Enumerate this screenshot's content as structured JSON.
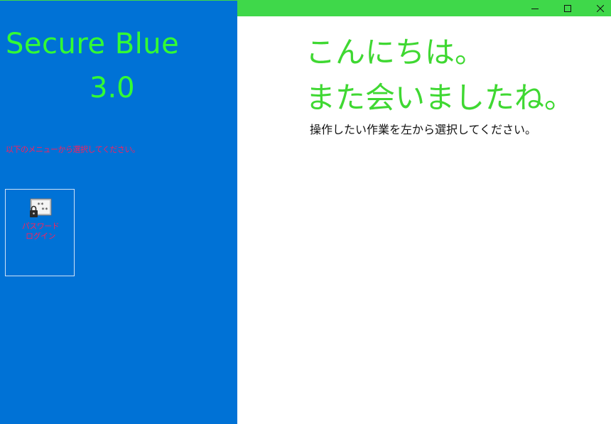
{
  "sidebar": {
    "app_title": "Secure Blue",
    "app_version": "3.0",
    "menu_hint": "以下のメニューから選択してください。",
    "menu_items": [
      {
        "label_line1": "パスワード",
        "label_line2": "ログイン",
        "icon": "password-lock-icon"
      }
    ]
  },
  "main": {
    "greeting_line1": "こんにちは。",
    "greeting_line2": "また会いましたね。",
    "instruction": "操作したい作業を左から選択してください。"
  },
  "window_controls": {
    "minimize_icon": "minimize-icon",
    "maximize_icon": "maximize-icon",
    "close_icon": "close-icon"
  },
  "colors": {
    "sidebar_bg": "#0072d6",
    "titlebar_bg": "#3fd84a",
    "title_text": "#33ff33",
    "hint_text": "#ff1e5a",
    "greeting_text": "#3fd832"
  }
}
